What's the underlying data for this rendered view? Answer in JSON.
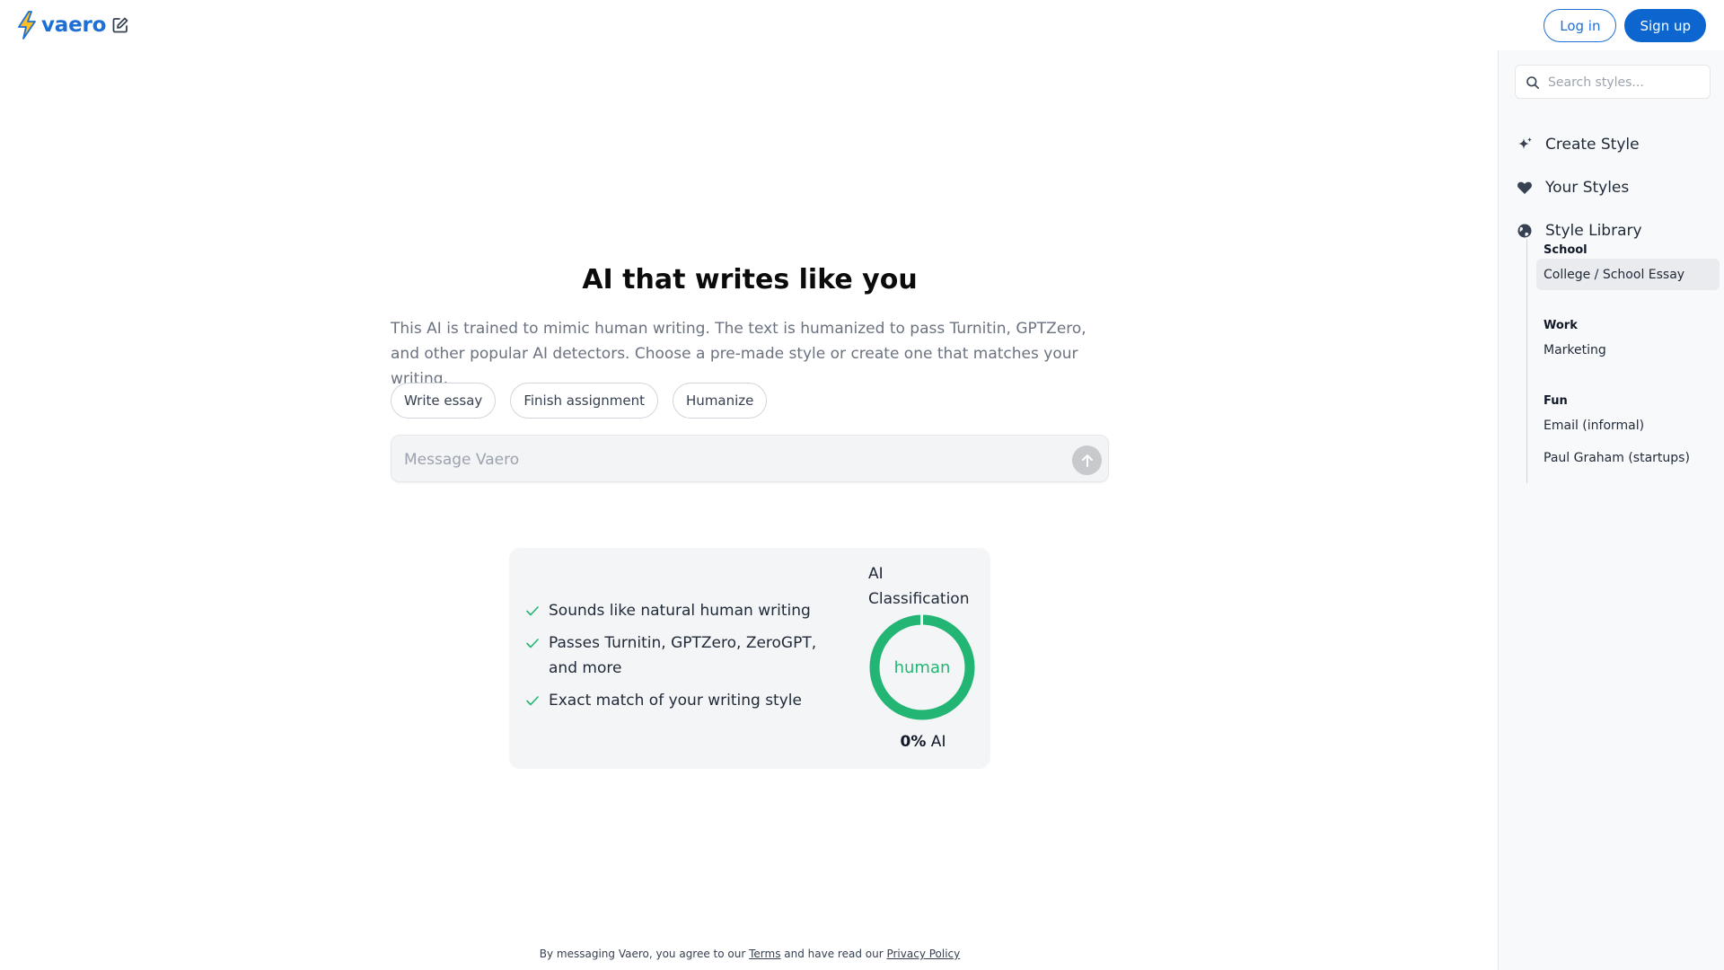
{
  "header": {
    "brand": "vaero",
    "login_label": "Log in",
    "signup_label": "Sign up"
  },
  "colors": {
    "brand": "#1e6fd4",
    "accent": "#0d66d0",
    "human_green": "#22b573"
  },
  "icons": {
    "logo": "lightning-bolt-icon",
    "new_chat": "edit-pencil-icon",
    "search": "search-icon",
    "create_style": "sparkle-icon",
    "your_styles": "heart-icon",
    "style_library": "globe-icon",
    "send": "arrow-up-icon",
    "feature_check": "check-icon"
  },
  "sidebar": {
    "search_placeholder": "Search styles...",
    "nav": [
      {
        "label": "Create Style"
      },
      {
        "label": "Your Styles"
      },
      {
        "label": "Style Library"
      }
    ],
    "library": {
      "groups": [
        {
          "heading": "School",
          "items": [
            "College / School Essay"
          ]
        },
        {
          "heading": "Work",
          "items": [
            "Marketing"
          ]
        },
        {
          "heading": "Fun",
          "items": [
            "Email (informal)",
            "Paul Graham (startups)"
          ]
        }
      ],
      "active_item": "College / School Essay"
    }
  },
  "main": {
    "title": "AI that writes like you",
    "description": "This AI is trained to mimic human writing. The text is humanized to pass Turnitin, GPTZero, and other popular AI detectors. Choose a pre-made style or create one that matches your writing.",
    "chips": [
      "Write essay",
      "Finish assignment",
      "Humanize"
    ],
    "composer_placeholder": "Message Vaero"
  },
  "card": {
    "features": [
      "Sounds like natural human writing",
      "Passes Turnitin, GPTZero, ZeroGPT, and more",
      "Exact match of your writing style"
    ],
    "classification_label": "AI Classification",
    "donut_text": "human",
    "ai_percent": "0%",
    "ai_suffix": " AI",
    "ai_fraction": 0
  },
  "footer": {
    "prefix": "By messaging Vaero, you agree to our ",
    "terms": "Terms",
    "middle": " and have read our ",
    "privacy": "Privacy Policy"
  }
}
